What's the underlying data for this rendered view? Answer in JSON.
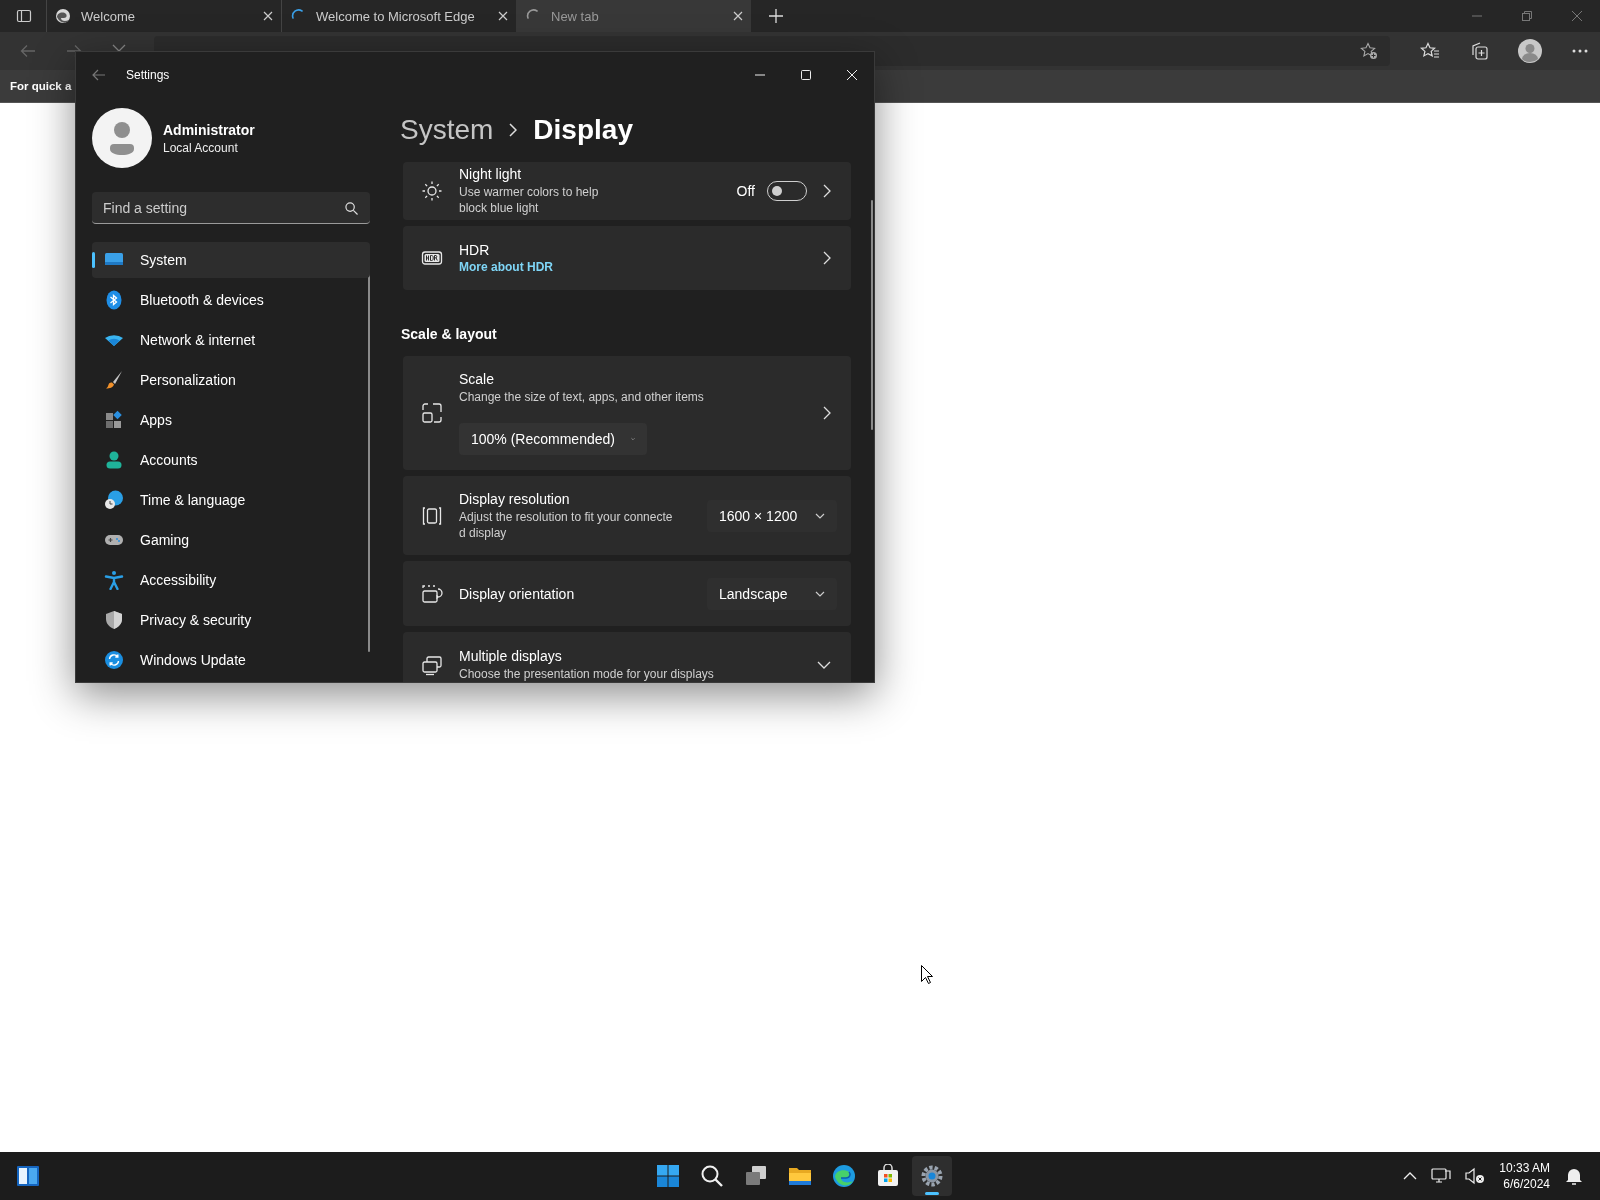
{
  "browser": {
    "tabs": [
      {
        "label": "Welcome",
        "selected": false,
        "kind": "loaded"
      },
      {
        "label": "Welcome to Microsoft Edge",
        "selected": false,
        "kind": "loading"
      },
      {
        "label": "New tab",
        "selected": true,
        "kind": "loading"
      }
    ],
    "favorites_bar": {
      "text": "For quick a"
    }
  },
  "settings": {
    "title": "Settings",
    "user": {
      "name": "Administrator",
      "account": "Local Account"
    },
    "search": {
      "placeholder": "Find a setting"
    },
    "nav": [
      {
        "label": "System",
        "selected": true
      },
      {
        "label": "Bluetooth & devices",
        "selected": false
      },
      {
        "label": "Network & internet",
        "selected": false
      },
      {
        "label": "Personalization",
        "selected": false
      },
      {
        "label": "Apps",
        "selected": false
      },
      {
        "label": "Accounts",
        "selected": false
      },
      {
        "label": "Time & language",
        "selected": false
      },
      {
        "label": "Gaming",
        "selected": false
      },
      {
        "label": "Accessibility",
        "selected": false
      },
      {
        "label": "Privacy & security",
        "selected": false
      },
      {
        "label": "Windows Update",
        "selected": false
      }
    ],
    "breadcrumb": [
      "System",
      "Display"
    ],
    "items": [
      {
        "kind": "toggle",
        "title": "Night light",
        "description": "Use warmer colors to help\nblock blue light",
        "state_label": "Off",
        "on": false
      },
      {
        "kind": "link",
        "title": "HDR",
        "link": "More about HDR"
      },
      {
        "kind": "heading",
        "title": "Scale & layout"
      },
      {
        "kind": "dropdown_below",
        "title": "Scale",
        "description": "Change the size of text, apps, and other items",
        "value": "100% (Recommended)"
      },
      {
        "kind": "dropdown",
        "title": "Display resolution",
        "description": "Adjust the resolution to fit your connecte\nd display",
        "value": "1600 × 1200"
      },
      {
        "kind": "dropdown",
        "title": "Display orientation",
        "value": "Landscape"
      },
      {
        "kind": "expander",
        "title": "Multiple displays",
        "description": "Choose the presentation mode for your displays",
        "expanded": false
      }
    ]
  },
  "taskbar": {
    "apps": [
      {
        "selected": false
      },
      {
        "selected": false
      },
      {
        "selected": false
      },
      {
        "selected": false
      },
      {
        "selected": false
      },
      {
        "selected": false
      },
      {
        "selected": true
      }
    ],
    "clock": {
      "time": "10:33 AM",
      "date": "6/6/2024"
    }
  }
}
